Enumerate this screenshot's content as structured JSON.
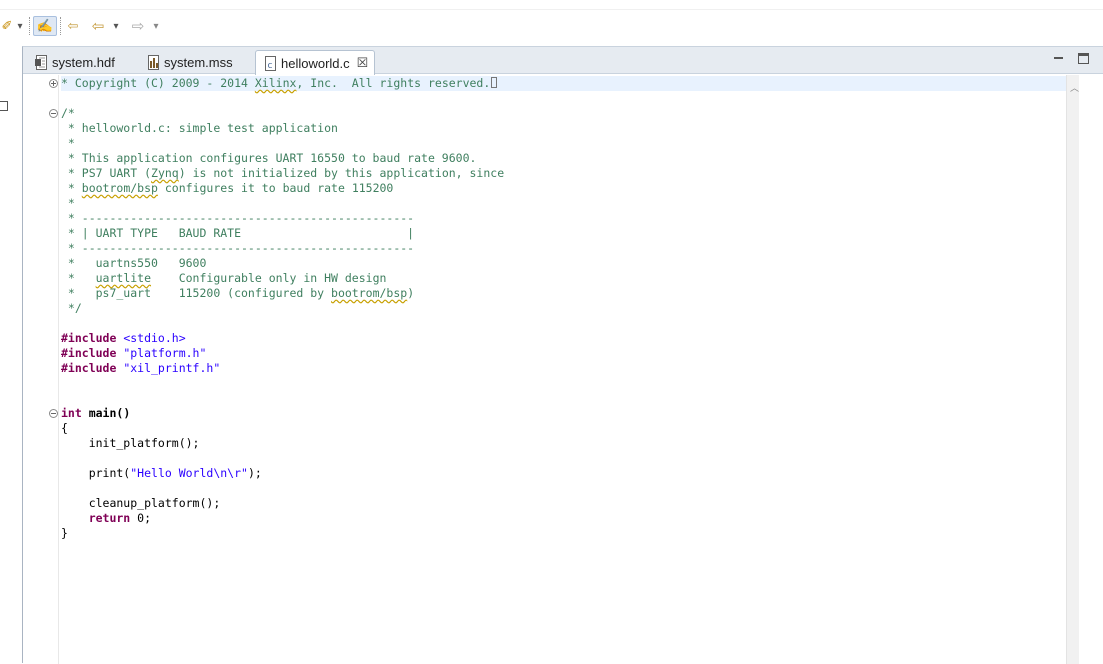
{
  "toolbar": {
    "items": [
      {
        "name": "pencil-icon",
        "glyph": "✐"
      },
      {
        "name": "dropdown-arrow",
        "glyph": "▾"
      },
      {
        "name": "highlight-toggle",
        "glyph": "✍"
      },
      {
        "name": "last-edit-icon",
        "glyph": "⇦"
      },
      {
        "name": "back-icon",
        "glyph": "⇦"
      },
      {
        "name": "back-dropdown",
        "glyph": "▾"
      },
      {
        "name": "forward-icon",
        "glyph": "⇨"
      },
      {
        "name": "forward-dropdown",
        "glyph": "▾"
      }
    ]
  },
  "tabs": [
    {
      "label": "system.hdf",
      "active": false,
      "icon": "hdf-file-icon"
    },
    {
      "label": "system.mss",
      "active": false,
      "icon": "mss-file-icon"
    },
    {
      "label": "helloworld.c",
      "active": true,
      "icon": "c-file-icon",
      "close": "☒"
    }
  ],
  "code": {
    "l1": "* Copyright (C) 2009 - 2014 ",
    "l1b": "Xilinx",
    "l1c": ", Inc.  All rights reserved.",
    "l3": "/*",
    "l4": " * helloworld.c: simple test application",
    "l5": " *",
    "l6": " * This application configures UART 16550 to baud rate 9600.",
    "l7a": " * PS7 UART (",
    "l7b": "Zynq",
    "l7c": ") is not initialized by this application, since",
    "l8a": " * ",
    "l8b": "bootrom/bsp",
    "l8c": " configures it to baud rate 115200",
    "l9": " *",
    "l10": " * ------------------------------------------------",
    "l11": " * | UART TYPE   BAUD RATE                        |",
    "l12": " * ------------------------------------------------",
    "l13": " *   uartns550   9600",
    "l14a": " *   ",
    "l14b": "uartlite",
    "l14c": "    Configurable only in HW design",
    "l15a": " *   ps7_uart    115200 (configured by ",
    "l15b": "bootrom/bsp",
    "l15c": ")",
    "l16": " */",
    "inc1_kw": "#include",
    "inc1_arg": " <stdio.h>",
    "inc2_kw": "#include",
    "inc2_arg": " \"platform.h\"",
    "inc3_kw": "#include",
    "inc3_arg": " \"xil_printf.h\"",
    "main_kw": "int",
    "main_sig": " main()",
    "brace_open": "{",
    "call1": "    init_platform();",
    "call2a": "    print(",
    "call2b": "\"Hello World\\n\\r\"",
    "call2c": ");",
    "call3": "    cleanup_platform();",
    "ret_kw": "    return",
    "ret_val": " 0;",
    "brace_close": "}"
  }
}
